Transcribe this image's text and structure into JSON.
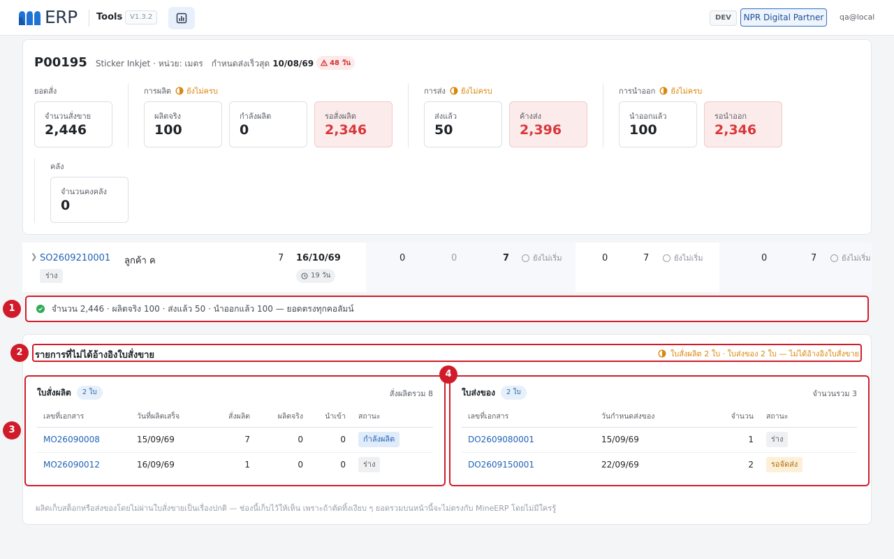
{
  "header": {
    "brand": "ERP",
    "app_name": "Tools",
    "version": "V1.3.2",
    "env_badge": "DEV",
    "partner_button": "NPR Digital Partner",
    "user": "qa@local"
  },
  "product": {
    "code": "P00195",
    "meta": "Sticker Inkjet · หน่วย: เมตร",
    "deadline_label": "กำหนดส่งเร็วสุด",
    "deadline_date": "10/08/69",
    "late_badge": "48 วัน",
    "groups": {
      "orders": {
        "label": "ยอดสั่ง",
        "stats": [
          {
            "label": "จำนวนสั่งขาย",
            "value": "2,446"
          }
        ]
      },
      "production": {
        "label": "การผลิต",
        "status": "ยังไม่ครบ",
        "stats": [
          {
            "label": "ผลิตจริง",
            "value": "100"
          },
          {
            "label": "กำลังผลิต",
            "value": "0"
          },
          {
            "label": "รอสั่งผลิต",
            "value": "2,346"
          }
        ]
      },
      "delivery": {
        "label": "การส่ง",
        "status": "ยังไม่ครบ",
        "stats": [
          {
            "label": "ส่งแล้ว",
            "value": "50"
          },
          {
            "label": "ค้างส่ง",
            "value": "2,396"
          }
        ]
      },
      "export": {
        "label": "การนำออก",
        "status": "ยังไม่ครบ",
        "stats": [
          {
            "label": "นำออกแล้ว",
            "value": "100"
          },
          {
            "label": "รอนำออก",
            "value": "2,346"
          }
        ]
      },
      "stock": {
        "label": "คลัง",
        "stats": [
          {
            "label": "จำนวนคงคลัง",
            "value": "0"
          }
        ]
      }
    }
  },
  "so_row": {
    "so_number": "SO2609210001",
    "status": "ร่าง",
    "customer": "ลูกค้า ค",
    "qty": "7",
    "date": "16/10/69",
    "days": "19 วัน",
    "prod": {
      "a": "0",
      "b": "0",
      "c": "7",
      "status": "ยังไม่เริ่ม"
    },
    "ship": {
      "a": "0",
      "b": "7",
      "status": "ยังไม่เริ่ม"
    },
    "out": {
      "a": "0",
      "b": "7",
      "status": "ยังไม่เริ่ม"
    }
  },
  "summary": {
    "text": "จำนวน 2,446 · ผลิตจริง 100 · ส่งแล้ว 50 · นำออกแล้ว 100 — ยอดตรงทุกคอลัมน์"
  },
  "markers": [
    "1",
    "2",
    "3",
    "4"
  ],
  "unreferenced": {
    "title": "รายการที่ไม่ได้อ้างอิงใบสั่งขาย",
    "warning": "ใบสั่งผลิต 2 ใบ · ใบส่งของ 2 ใบ — ไม่ได้อ้างอิงใบสั่งขาย",
    "mo_panel": {
      "title": "ใบสั่งผลิต",
      "count": "2 ใบ",
      "total": "สั่งผลิตรวม 8",
      "columns": [
        "เลขที่เอกสาร",
        "วันที่ผลิตเสร็จ",
        "สั่งผลิต",
        "ผลิตจริง",
        "นำเข้า",
        "สถานะ"
      ],
      "rows": [
        {
          "doc": "MO26090008",
          "date": "15/09/69",
          "ordered": "7",
          "produced": "0",
          "imported": "0",
          "status": "กำลังผลิต",
          "status_kind": "blue"
        },
        {
          "doc": "MO26090012",
          "date": "16/09/69",
          "ordered": "1",
          "produced": "0",
          "imported": "0",
          "status": "ร่าง",
          "status_kind": "gray"
        }
      ]
    },
    "do_panel": {
      "title": "ใบส่งของ",
      "count": "2 ใบ",
      "total": "จำนวนรวม 3",
      "columns": [
        "เลขที่เอกสาร",
        "วันกำหนดส่งของ",
        "จำนวน",
        "สถานะ"
      ],
      "rows": [
        {
          "doc": "DO2609080001",
          "date": "15/09/69",
          "qty": "1",
          "status": "ร่าง",
          "status_kind": "gray"
        },
        {
          "doc": "DO2609150001",
          "date": "22/09/69",
          "qty": "2",
          "status": "รอจัดส่ง",
          "status_kind": "amber"
        }
      ]
    },
    "footnote": "ผลิตเก็บสต็อกหรือส่งของโดยไม่ผ่านใบสั่งขายเป็นเรื่องปกติ — ช่องนี้เก็บไว้ให้เห็น เพราะถ้าตัดทิ้งเงียบ ๆ ยอดรวมบนหน้านี้จะไม่ตรงกับ MineERP โดยไม่มีใครรู้"
  },
  "colors": {
    "accent": "#1f62b5",
    "annotation_red": "#d01c2a",
    "warning": "#d9870f",
    "alert_value": "#d9363a",
    "ok": "#2eaa57"
  }
}
